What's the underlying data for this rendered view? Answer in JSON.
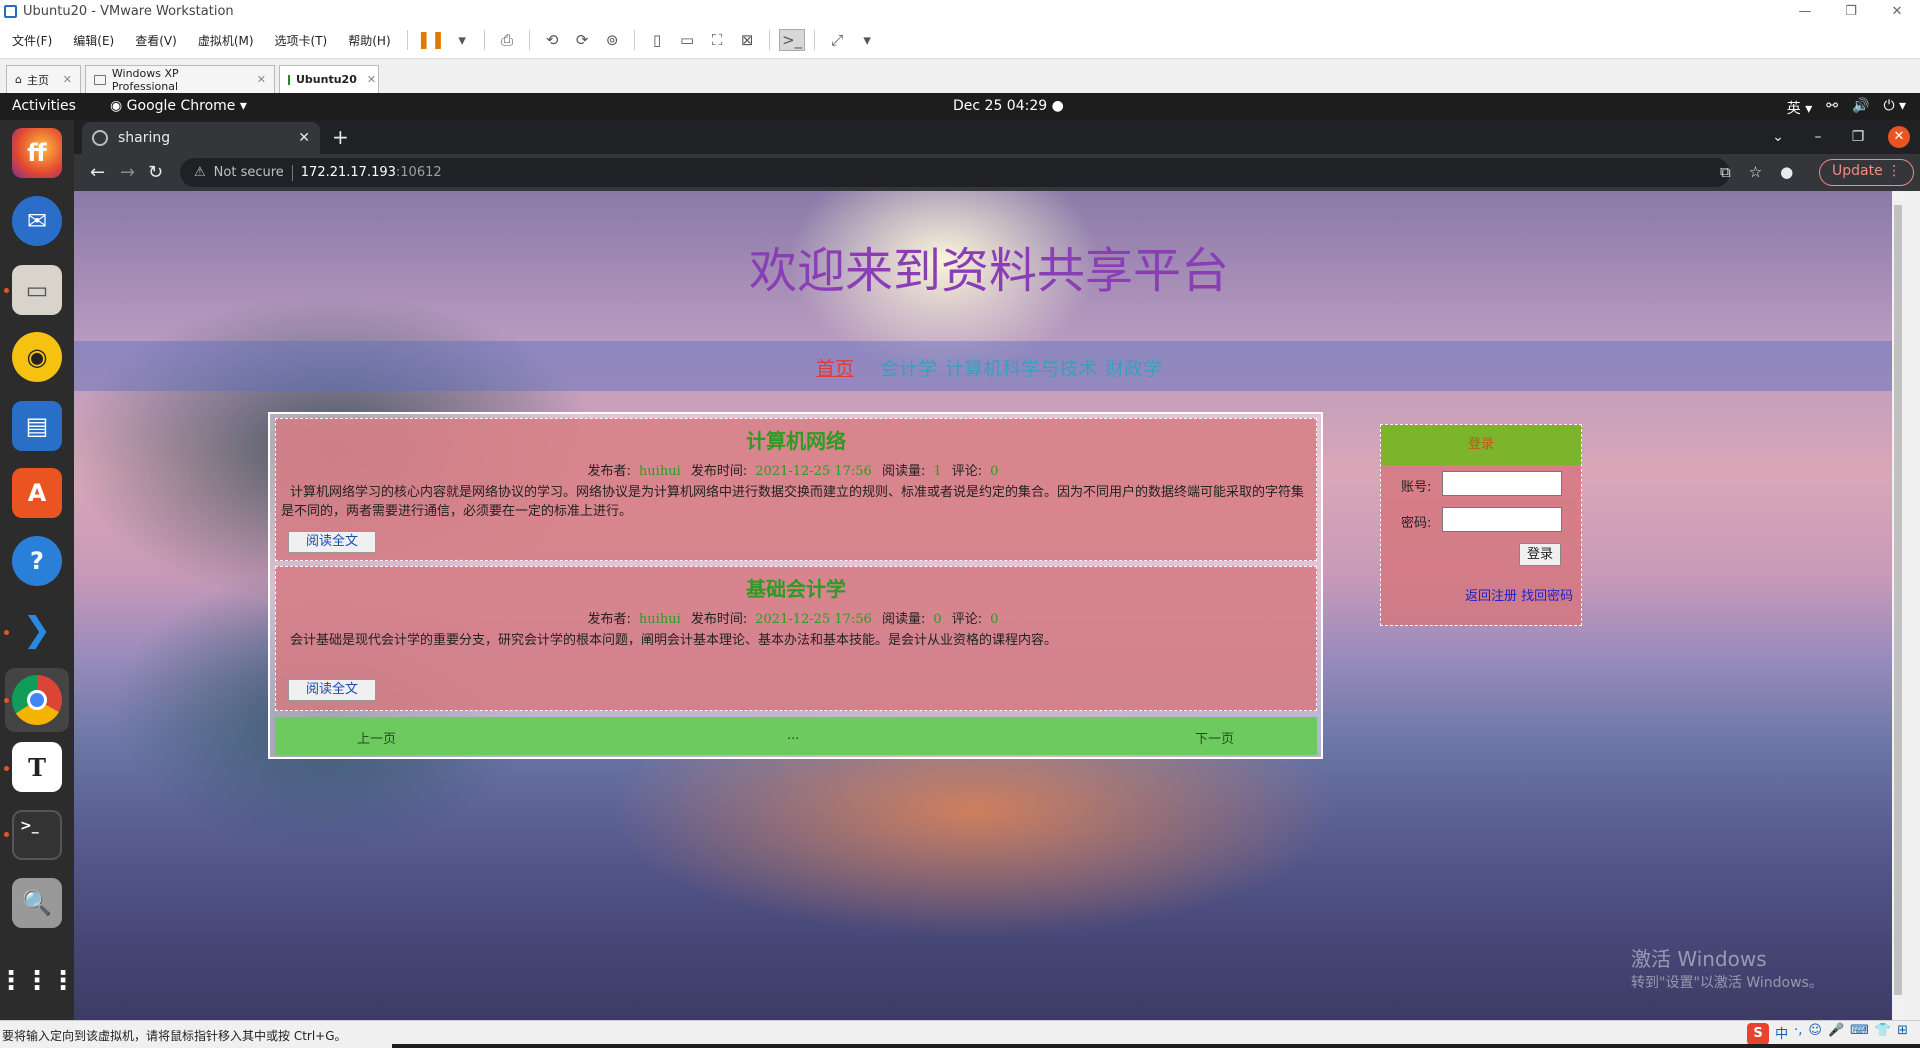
{
  "vmware": {
    "title": "Ubuntu20 - VMware Workstation",
    "menu": [
      "文件(F)",
      "编辑(E)",
      "查看(V)",
      "虚拟机(M)",
      "选项卡(T)",
      "帮助(H)"
    ],
    "tabs": [
      {
        "label": "主页",
        "icon": "home-icon"
      },
      {
        "label": "Windows XP Professional",
        "icon": "vm-icon"
      },
      {
        "label": "Ubuntu20",
        "icon": "vm-running-icon"
      }
    ],
    "status": "要将输入定向到该虚拟机，请将鼠标指针移入其中或按 Ctrl+G。",
    "ime": [
      "中",
      "·,",
      "☺",
      "🎤",
      "⌨",
      "👕",
      "⊞"
    ]
  },
  "ubuntu": {
    "activities": "Activities",
    "app": "Google Chrome",
    "clock": "Dec 25  04:29",
    "lang": "英"
  },
  "chrome": {
    "tab_title": "sharing",
    "not_secure": "Not secure",
    "host": "172.21.17.193",
    "port": ":10612",
    "update": "Update"
  },
  "page": {
    "banner": "欢迎来到资料共享平台",
    "menu": {
      "home": "首页",
      "cat1": "会计学",
      "cat2": "计算机科学与技术",
      "cat3": "财政学"
    },
    "meta_labels": {
      "author": "发布者:",
      "time": "发布时间:",
      "reads": "阅读量:",
      "comments": "评论:"
    },
    "articles": [
      {
        "title": "计算机网络",
        "author": "huihui",
        "time": "2021-12-25 17:56",
        "reads": "1",
        "comments": "0",
        "body": "计算机网络学习的核心内容就是网络协议的学习。网络协议是为计算机网络中进行数据交换而建立的规则、标准或者说是约定的集合。因为不同用户的数据终端可能采取的字符集是不同的，两者需要进行通信，必须要在一定的标准上进行。",
        "button": "阅读全文"
      },
      {
        "title": "基础会计学",
        "author": "huihui",
        "time": "2021-12-25 17:56",
        "reads": "0",
        "comments": "0",
        "body": "会计基础是现代会计学的重要分支，研究会计学的根本问题，阐明会计基本理论、基本办法和基本技能。是会计从业资格的课程内容。",
        "button": "阅读全文"
      }
    ],
    "pager": {
      "prev": "上一页",
      "mid": "...",
      "next": "下一页"
    },
    "login": {
      "header": "登录",
      "account_label": "账号:",
      "password_label": "密码:",
      "submit": "登录",
      "register": "返回注册",
      "forgot": "找回密码"
    },
    "watermark": {
      "line1": "激活 Windows",
      "line2": "转到\"设置\"以激活 Windows。"
    }
  },
  "colors": {
    "banner": "#8a3eb5",
    "home_link": "#e03b3b",
    "category_link": "#3a9fbf",
    "article_bg": "#d5767e",
    "green_text": "#2d9b24",
    "pager_bg": "#6dca5e",
    "login_header": "#7cb52b"
  }
}
